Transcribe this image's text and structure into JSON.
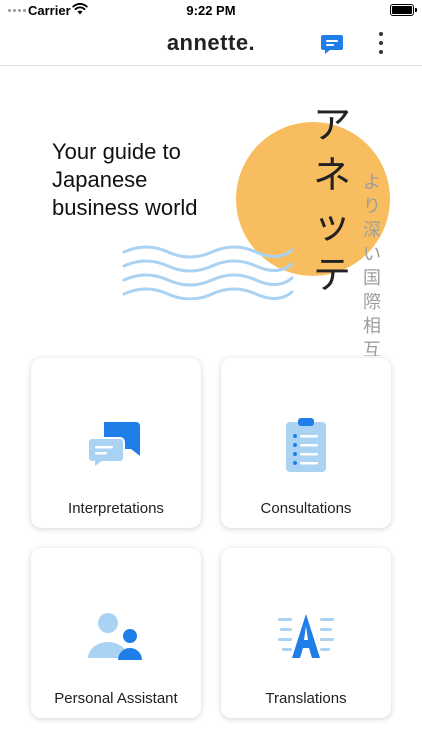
{
  "status_bar": {
    "carrier": "Carrier",
    "time": "9:22 PM"
  },
  "header": {
    "title": "annette.",
    "message_icon": "message-icon",
    "more_icon": "more-vertical-icon"
  },
  "hero": {
    "tagline_lines": [
      "Your guide to",
      "Japanese",
      "business world"
    ],
    "katakana": [
      "ア",
      "ネ",
      "ッ",
      "テ"
    ],
    "vertical_text": [
      "よ",
      "り",
      "深",
      "い",
      "国",
      "際",
      "相",
      "互"
    ],
    "sun_color": "#f8bd5e",
    "wave_color": "#a9d2f3"
  },
  "services": [
    {
      "label": "Interpretations",
      "icon": "chat-bubbles-icon"
    },
    {
      "label": "Consultations",
      "icon": "clipboard-icon"
    },
    {
      "label": "Personal Assistant",
      "icon": "people-icon"
    },
    {
      "label": "Translations",
      "icon": "text-translate-icon"
    }
  ],
  "colors": {
    "accent": "#1f7ee8",
    "accent_light": "#a9d2f3"
  }
}
